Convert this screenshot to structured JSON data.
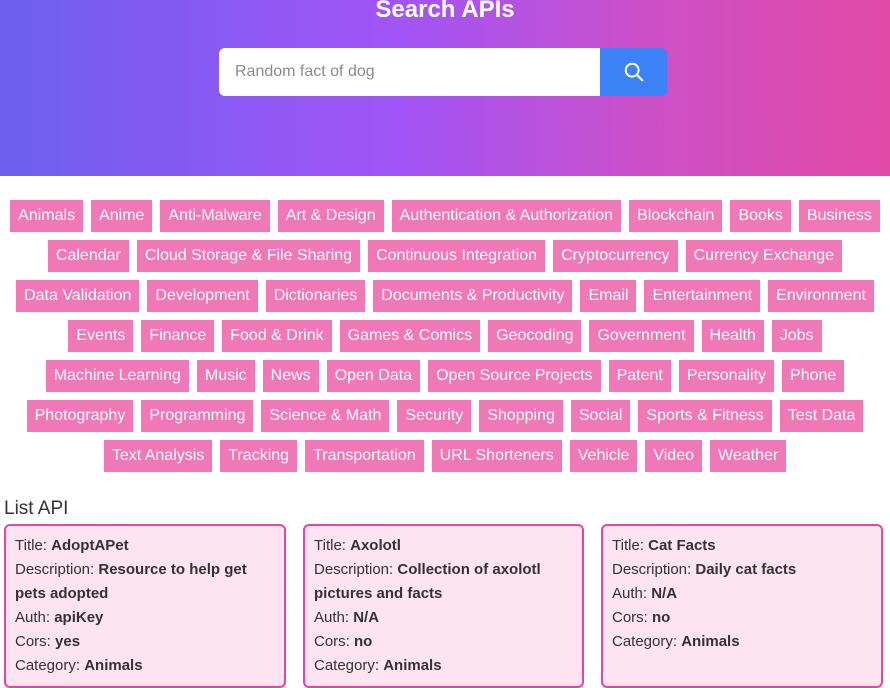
{
  "header": {
    "title": "Search APIs"
  },
  "search": {
    "placeholder": "Random fact of dog",
    "value": ""
  },
  "categories": [
    "Animals",
    "Anime",
    "Anti-Malware",
    "Art & Design",
    "Authentication & Authorization",
    "Blockchain",
    "Books",
    "Business",
    "Calendar",
    "Cloud Storage & File Sharing",
    "Continuous Integration",
    "Cryptocurrency",
    "Currency Exchange",
    "Data Validation",
    "Development",
    "Dictionaries",
    "Documents & Productivity",
    "Email",
    "Entertainment",
    "Environment",
    "Events",
    "Finance",
    "Food & Drink",
    "Games & Comics",
    "Geocoding",
    "Government",
    "Health",
    "Jobs",
    "Machine Learning",
    "Music",
    "News",
    "Open Data",
    "Open Source Projects",
    "Patent",
    "Personality",
    "Phone",
    "Photography",
    "Programming",
    "Science & Math",
    "Security",
    "Shopping",
    "Social",
    "Sports & Fitness",
    "Test Data",
    "Text Analysis",
    "Tracking",
    "Transportation",
    "URL Shorteners",
    "Vehicle",
    "Video",
    "Weather"
  ],
  "list": {
    "title": "List API",
    "labels": {
      "title": "Title: ",
      "description": "Description: ",
      "auth": "Auth: ",
      "cors": "Cors: ",
      "category": "Category: "
    },
    "items": [
      {
        "title": "AdoptAPet",
        "description": "Resource to help get pets adopted",
        "auth": "apiKey",
        "cors": "yes",
        "category": "Animals"
      },
      {
        "title": "Axolotl",
        "description": "Collection of axolotl pictures and facts",
        "auth": "N/A",
        "cors": "no",
        "category": "Animals"
      },
      {
        "title": "Cat Facts",
        "description": "Daily cat facts",
        "auth": "N/A",
        "cors": "no",
        "category": "Animals"
      }
    ]
  },
  "colors": {
    "accent": "#3b82f6",
    "tag": "#f178b6",
    "card_border": "#e4479c",
    "card_bg": "#fde4f0"
  }
}
